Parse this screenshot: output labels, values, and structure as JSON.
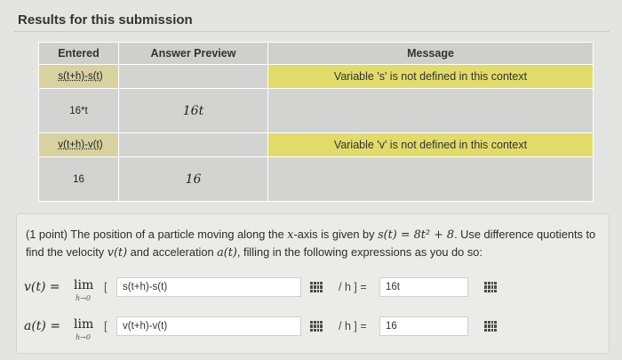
{
  "page": {
    "title": "Results for this submission"
  },
  "table": {
    "headers": {
      "entered": "Entered",
      "preview": "Answer Preview",
      "message": "Message"
    },
    "rows": [
      {
        "entered": "s(t+h)-s(t)",
        "preview": "",
        "message": "Variable 's' is not defined in this context",
        "highlight": true
      },
      {
        "entered": "16*t",
        "preview": "16t",
        "message": "",
        "highlight": false
      },
      {
        "entered": "v(t+h)-v(t)",
        "preview": "",
        "message": "Variable 'v' is not defined in this context",
        "highlight": true
      },
      {
        "entered": "16",
        "preview": "16",
        "message": "",
        "highlight": false
      }
    ]
  },
  "problem": {
    "points": "(1 point)",
    "text_1": " The position of a particle moving along the ",
    "x_var": "x",
    "text_2": "-axis is given by ",
    "s_eq": "s(t) = 8t² + 8",
    "text_3": ". Use difference quotients to find the velocity ",
    "v_var": "v(t)",
    "text_4": " and acceleration ",
    "a_var": "a(t)",
    "text_5": ", filling in the following expressions as you do so:",
    "velocity": {
      "lhs": "v(t) = ",
      "lim": "lim",
      "lim_sub": "h→0",
      "bracket": "[",
      "numerator_value": "s(t+h)-s(t)",
      "divider": "/ h ] =",
      "result_value": "16t"
    },
    "acceleration": {
      "lhs": "a(t) = ",
      "lim": "lim",
      "lim_sub": "h→0",
      "bracket": "[",
      "numerator_value": "v(t+h)-v(t)",
      "divider": "/ h ] =",
      "result_value": "16"
    }
  },
  "colors": {
    "highlight_message": "#e1dc6a",
    "highlight_entered": "#d7d2a0",
    "cell": "#d3d3d1"
  }
}
